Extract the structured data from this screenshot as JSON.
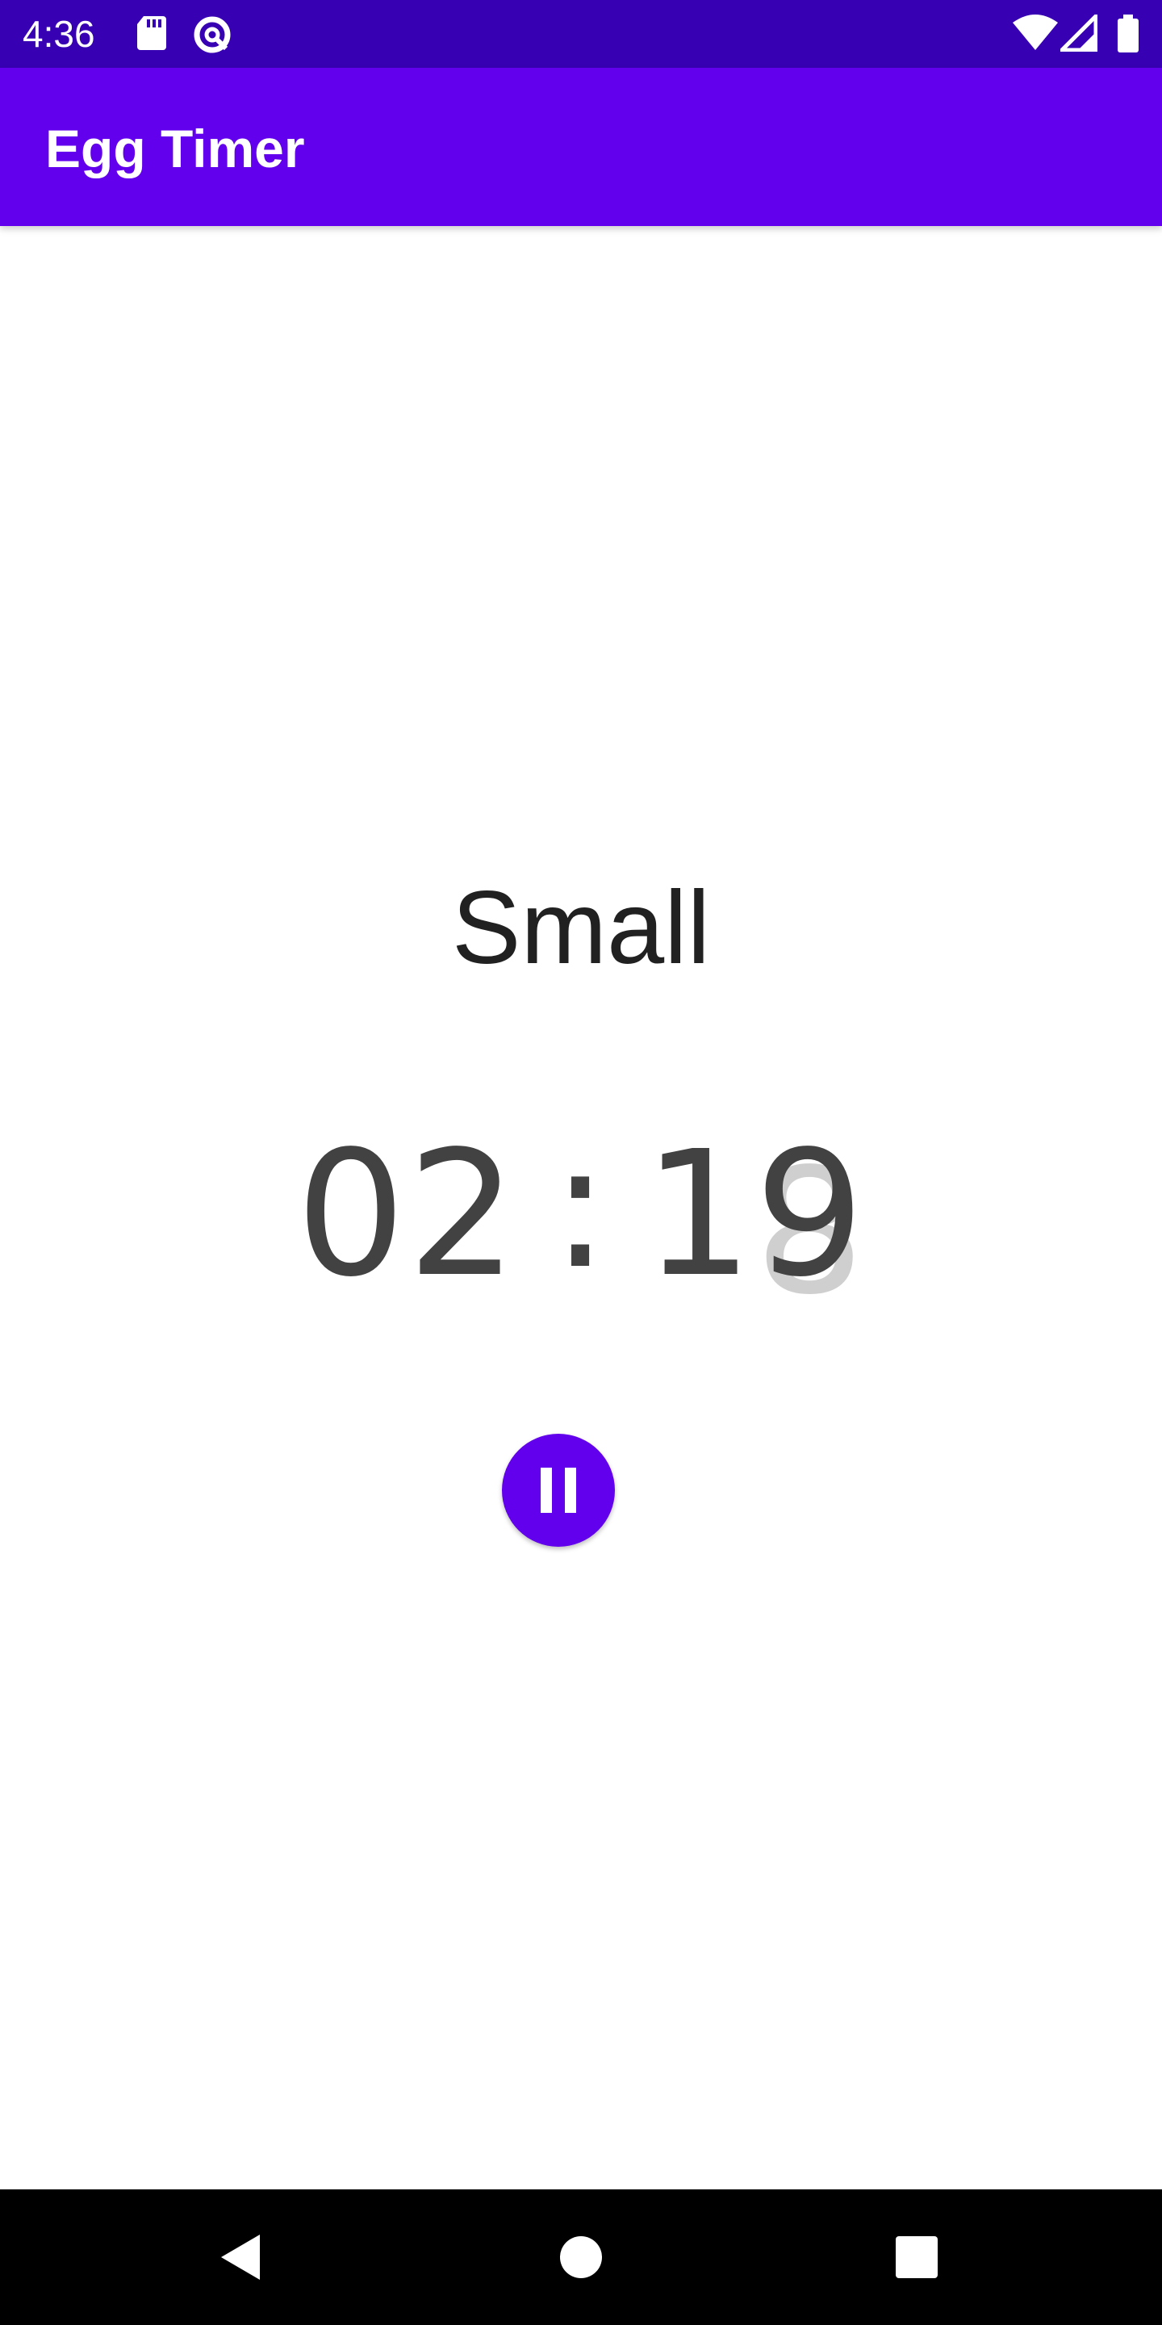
{
  "status_bar": {
    "time": "4:36",
    "left_icons": [
      "sd-card-icon",
      "data-saver-icon"
    ],
    "right_icons": [
      "wifi-icon",
      "cellular-signal-icon",
      "battery-icon"
    ],
    "background": "#3700b3"
  },
  "app_bar": {
    "title": "Egg Timer",
    "background": "#6200ee"
  },
  "main": {
    "egg_size": "Small",
    "timer": {
      "minutes": "02",
      "separator": ":",
      "seconds_tens": "1",
      "seconds_ones": "9",
      "seconds_ones_transition": "8"
    },
    "pause_button": {
      "icon": "pause-icon",
      "color": "#6200ee"
    }
  },
  "nav_bar": {
    "buttons": [
      "back-icon",
      "home-icon",
      "recents-icon"
    ],
    "background": "#000000"
  }
}
